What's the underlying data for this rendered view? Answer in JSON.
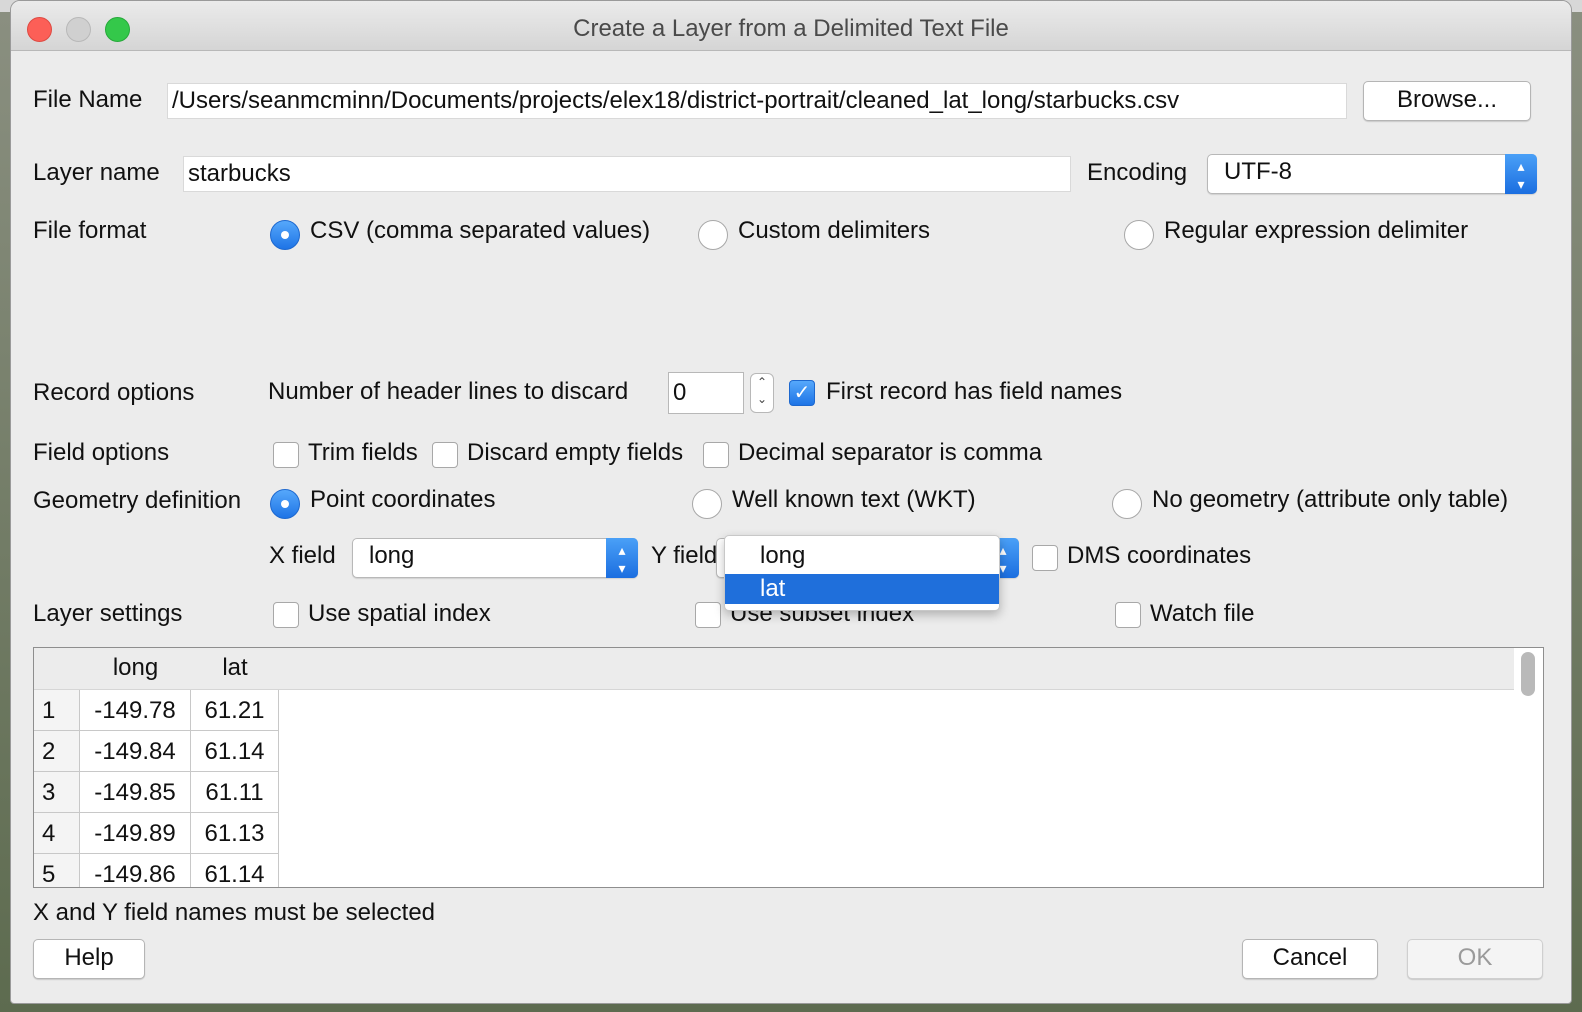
{
  "window": {
    "title": "Create a Layer from a Delimited Text File"
  },
  "file_name": {
    "label": "File Name",
    "value": "/Users/seanmcminn/Documents/projects/elex18/district-portrait/cleaned_lat_long/starbucks.csv",
    "browse_label": "Browse..."
  },
  "layer_name": {
    "label": "Layer name",
    "value": "starbucks"
  },
  "encoding": {
    "label": "Encoding",
    "value": "UTF-8"
  },
  "file_format": {
    "label": "File format",
    "options": [
      "CSV (comma separated values)",
      "Custom delimiters",
      "Regular expression delimiter"
    ],
    "selected": "CSV (comma separated values)"
  },
  "record_options": {
    "label": "Record options",
    "header_lines_label": "Number of header lines to discard",
    "header_lines_value": "0",
    "first_record_label": "First record has field names",
    "first_record_checked": true
  },
  "field_options": {
    "label": "Field options",
    "trim": "Trim fields",
    "discard_empty": "Discard empty fields",
    "decimal_comma": "Decimal separator is comma"
  },
  "geometry": {
    "label": "Geometry definition",
    "options": [
      "Point coordinates",
      "Well known text (WKT)",
      "No geometry (attribute only table)"
    ],
    "selected": "Point coordinates",
    "x_label": "X field",
    "x_value": "long",
    "y_label": "Y field",
    "dms_label": "DMS coordinates",
    "y_dropdown": {
      "options": [
        "long",
        "lat"
      ],
      "highlighted": "lat"
    }
  },
  "layer_settings": {
    "label": "Layer settings",
    "spatial_index": "Use spatial index",
    "subset_index": "Use subset index",
    "watch_file": "Watch file"
  },
  "preview": {
    "columns": [
      "long",
      "lat"
    ],
    "rows": [
      {
        "n": "1",
        "long": "-149.78",
        "lat": "61.21"
      },
      {
        "n": "2",
        "long": "-149.84",
        "lat": "61.14"
      },
      {
        "n": "3",
        "long": "-149.85",
        "lat": "61.11"
      },
      {
        "n": "4",
        "long": "-149.89",
        "lat": "61.13"
      },
      {
        "n": "5",
        "long": "-149.86",
        "lat": "61.14"
      }
    ]
  },
  "status_message": "X and Y field names must be selected",
  "buttons": {
    "help": "Help",
    "cancel": "Cancel",
    "ok": "OK"
  },
  "colors": {
    "accent": "#1f6fdb",
    "close": "#fc5f57",
    "maximize": "#34c84a"
  }
}
